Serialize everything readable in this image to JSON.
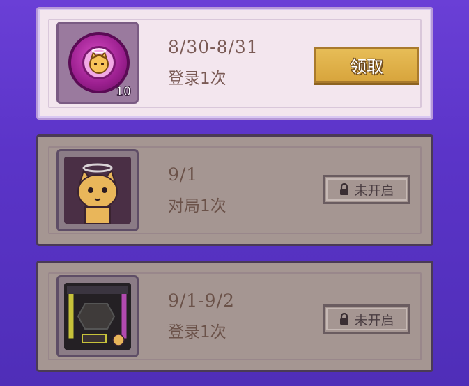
{
  "rewards": [
    {
      "date": "8/30-8/31",
      "description": "登录1次",
      "item_count": "10",
      "item_icon": "coin-icon",
      "state": "claimable",
      "button_label": "领取"
    },
    {
      "date": "9/1",
      "description": "对局1次",
      "item_icon": "cat-avatar-icon",
      "state": "locked",
      "badge_label": "未开启"
    },
    {
      "date": "9/1-9/2",
      "description": "登录1次",
      "item_icon": "profile-frame-icon",
      "state": "locked",
      "badge_label": "未开启"
    }
  ],
  "colors": {
    "background": "#5b34c8",
    "claim_button": "#d8a53d",
    "text": "#7a5a55"
  }
}
